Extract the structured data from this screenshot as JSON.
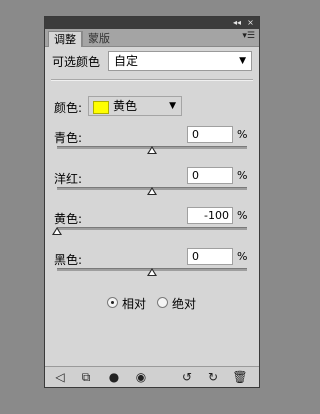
{
  "titlebar": {
    "collapse_icon": "◂◂",
    "close_icon": "×"
  },
  "tabs": [
    {
      "label": "调整",
      "active": true
    },
    {
      "label": "蒙版",
      "active": false
    }
  ],
  "tab_menu_icon": "▾☰",
  "preset": {
    "label": "可选颜色",
    "value": "自定"
  },
  "colors": {
    "label": "颜色:",
    "selected": "黄色",
    "swatch": "#ffff00"
  },
  "sliders": [
    {
      "label": "青色:",
      "value": "0",
      "unit": "%",
      "level": 0
    },
    {
      "label": "洋红:",
      "value": "0",
      "unit": "%",
      "level": 0
    },
    {
      "label": "黄色:",
      "value": "-100",
      "unit": "%",
      "level": -100
    },
    {
      "label": "黑色:",
      "value": "0",
      "unit": "%",
      "level": 0
    }
  ],
  "method": {
    "relative_label": "相对",
    "absolute_label": "绝对",
    "selected": "relative"
  },
  "bottom_icons": [
    "back-arrow-icon",
    "clip-layer-icon",
    "mask-icon",
    "visibility-eye-icon",
    "previous-state-icon",
    "reset-icon",
    "trash-icon"
  ]
}
